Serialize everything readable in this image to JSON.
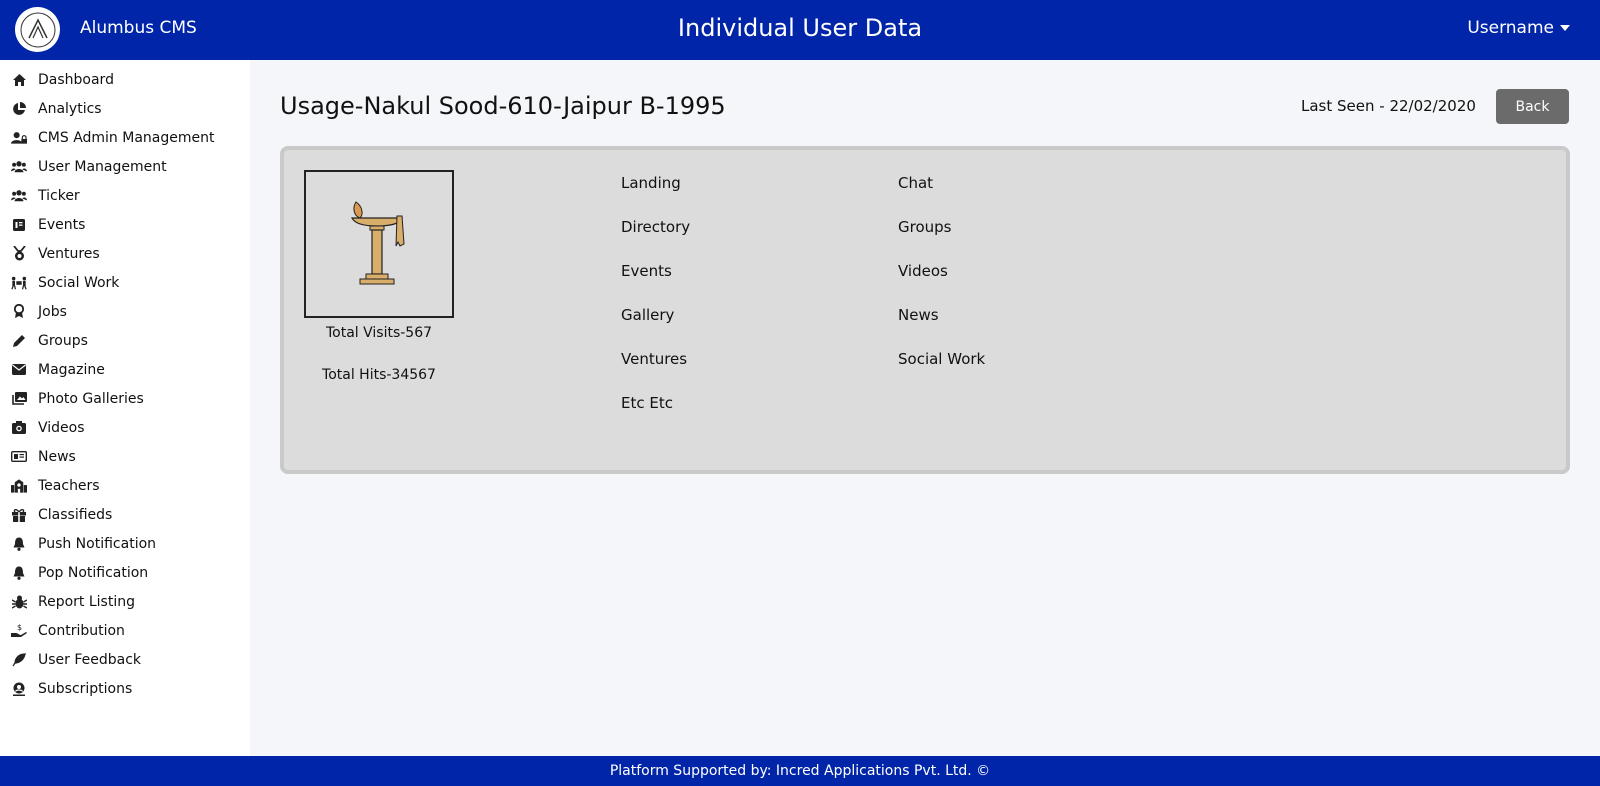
{
  "header": {
    "brand": "Alumbus CMS",
    "page_heading": "Individual User Data",
    "user_menu": "Username",
    "color": "#0025a8"
  },
  "sidebar": {
    "items": [
      {
        "label": "Dashboard",
        "icon": "home-icon"
      },
      {
        "label": "Analytics",
        "icon": "chart-pie-icon"
      },
      {
        "label": "CMS Admin Management",
        "icon": "user-lock-icon"
      },
      {
        "label": "User Management",
        "icon": "users-icon"
      },
      {
        "label": "Ticker",
        "icon": "users-icon"
      },
      {
        "label": "Events",
        "icon": "calendar-icon"
      },
      {
        "label": "Ventures",
        "icon": "medal-icon"
      },
      {
        "label": "Social Work",
        "icon": "people-carry-icon"
      },
      {
        "label": "Jobs",
        "icon": "award-icon"
      },
      {
        "label": "Groups",
        "icon": "pen-icon"
      },
      {
        "label": "Magazine",
        "icon": "envelope-icon"
      },
      {
        "label": "Photo Galleries",
        "icon": "images-icon"
      },
      {
        "label": "Videos",
        "icon": "camera-icon"
      },
      {
        "label": "News",
        "icon": "newspaper-icon"
      },
      {
        "label": "Teachers",
        "icon": "school-icon"
      },
      {
        "label": "Classifieds",
        "icon": "gift-icon"
      },
      {
        "label": "Push Notification",
        "icon": "bell-icon"
      },
      {
        "label": "Pop Notification",
        "icon": "bell-icon"
      },
      {
        "label": "Report Listing",
        "icon": "bug-icon"
      },
      {
        "label": "Contribution",
        "icon": "hand-holding-usd-icon"
      },
      {
        "label": "User Feedback",
        "icon": "feather-icon"
      },
      {
        "label": "Subscriptions",
        "icon": "user-circle-icon"
      }
    ]
  },
  "main": {
    "title": "Usage-Nakul Sood-610-Jaipur B-1995",
    "last_seen": "Last Seen - 22/02/2020",
    "back_label": "Back",
    "total_visits": "Total Visits-567",
    "total_hits": "Total Hits-34567",
    "links_col1": [
      "Landing",
      "Directory",
      "Events",
      "Gallery",
      "Ventures",
      "Etc Etc"
    ],
    "links_col2": [
      "Chat",
      "Groups",
      "Videos",
      "News",
      "Social Work"
    ]
  },
  "footer": {
    "text": "Platform Supported by: Incred Applications Pvt. Ltd. ©"
  }
}
